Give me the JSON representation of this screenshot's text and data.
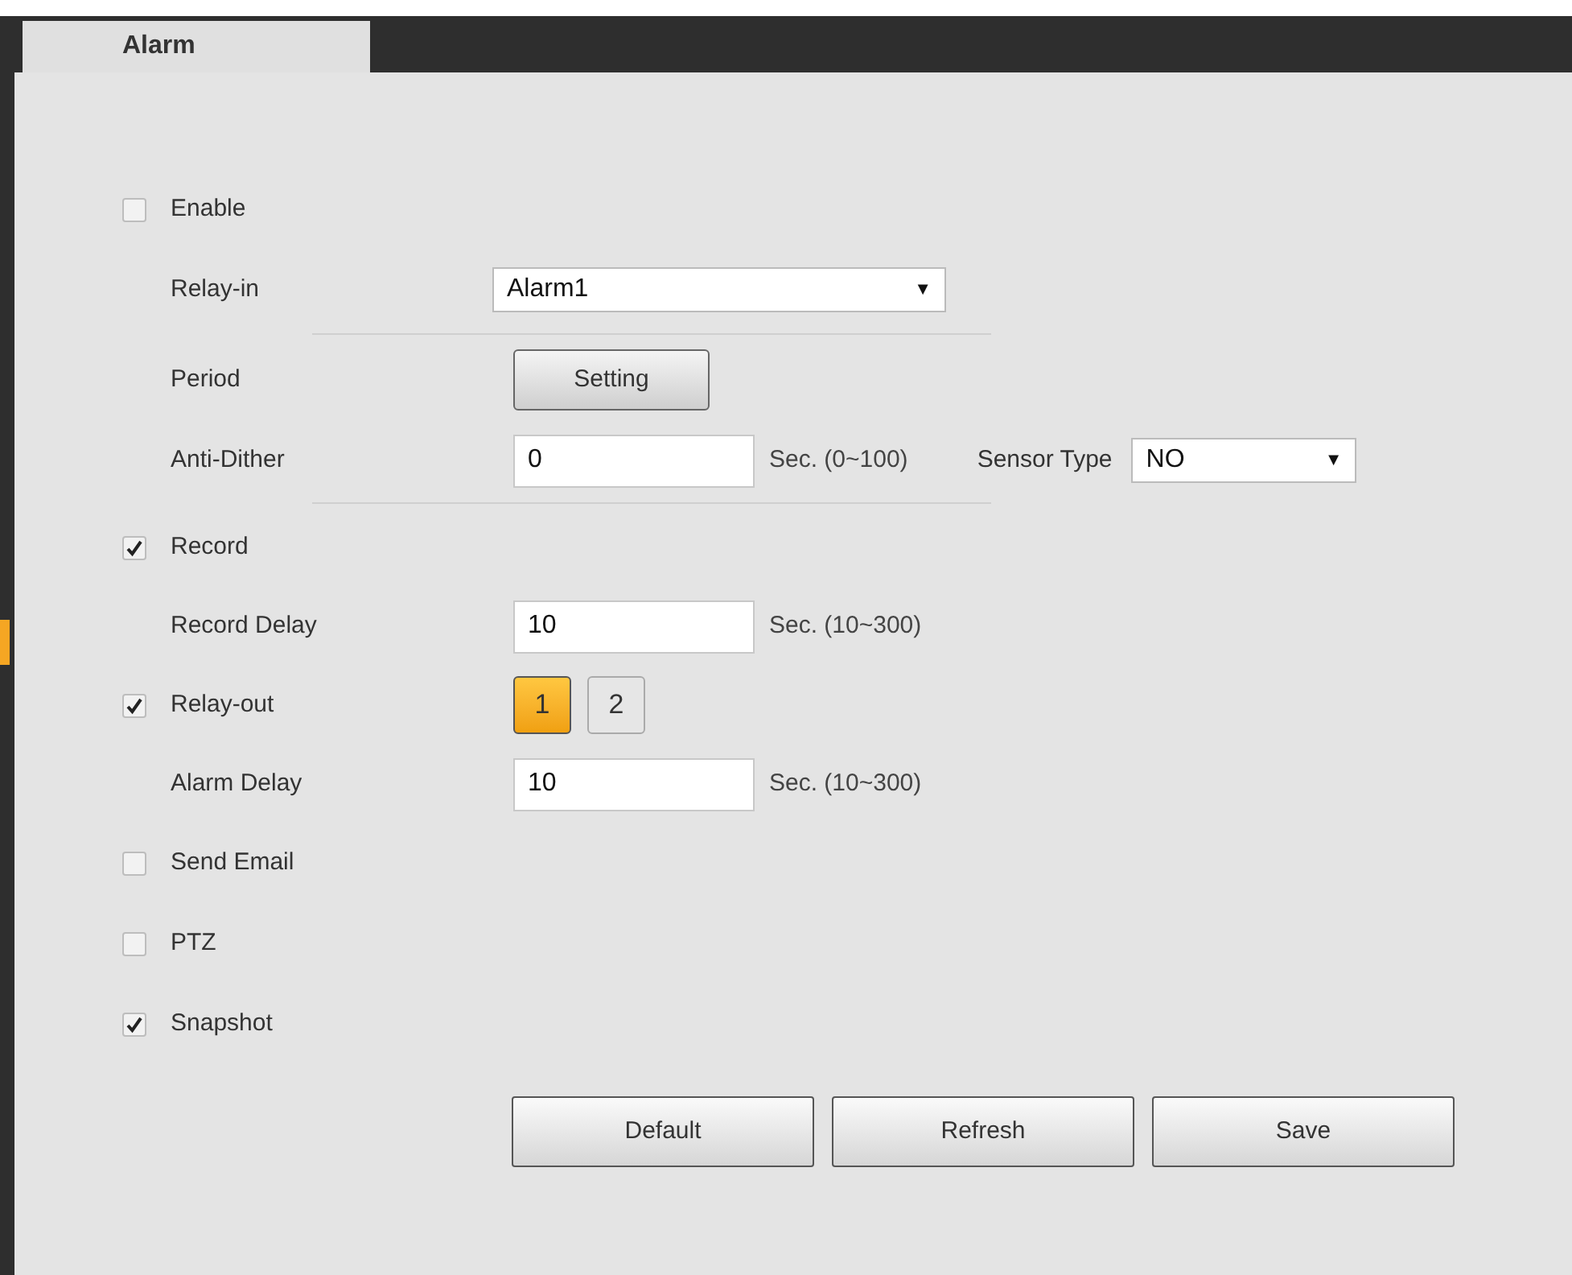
{
  "tabs": [
    {
      "label": "Alarm",
      "selected": true
    }
  ],
  "rows": [
    {
      "kind": "checkbox",
      "label": "Enable",
      "checked": false
    },
    {
      "kind": "select",
      "label": "Relay-in",
      "value": "Alarm1",
      "caret": "▼"
    },
    {
      "kind": "divider"
    },
    {
      "kind": "button",
      "label": "Period",
      "button": "Setting"
    },
    {
      "kind": "input",
      "label": "Anti-Dither",
      "value": "0",
      "hint": "Sec. (0~100)",
      "extra": {
        "label": "Sensor Type",
        "value": "NO",
        "caret": "▼"
      }
    },
    {
      "kind": "divider"
    },
    {
      "kind": "checkbox",
      "label": "Record",
      "checked": true
    },
    {
      "kind": "input",
      "label": "Record Delay",
      "value": "10",
      "hint": "Sec. (10~300)"
    },
    {
      "kind": "relays",
      "label": "Relay-out",
      "checked": true,
      "options": [
        {
          "label": "1",
          "selected": true
        },
        {
          "label": "2",
          "selected": false
        }
      ]
    },
    {
      "kind": "input",
      "label": "Alarm Delay",
      "value": "10",
      "hint": "Sec. (10~300)"
    },
    {
      "kind": "checkbox",
      "label": "Send Email",
      "checked": false
    },
    {
      "kind": "checkbox",
      "label": "PTZ",
      "checked": false
    },
    {
      "kind": "checkbox",
      "label": "Snapshot",
      "checked": true
    }
  ],
  "buttons": [
    "Default",
    "Refresh",
    "Save"
  ]
}
